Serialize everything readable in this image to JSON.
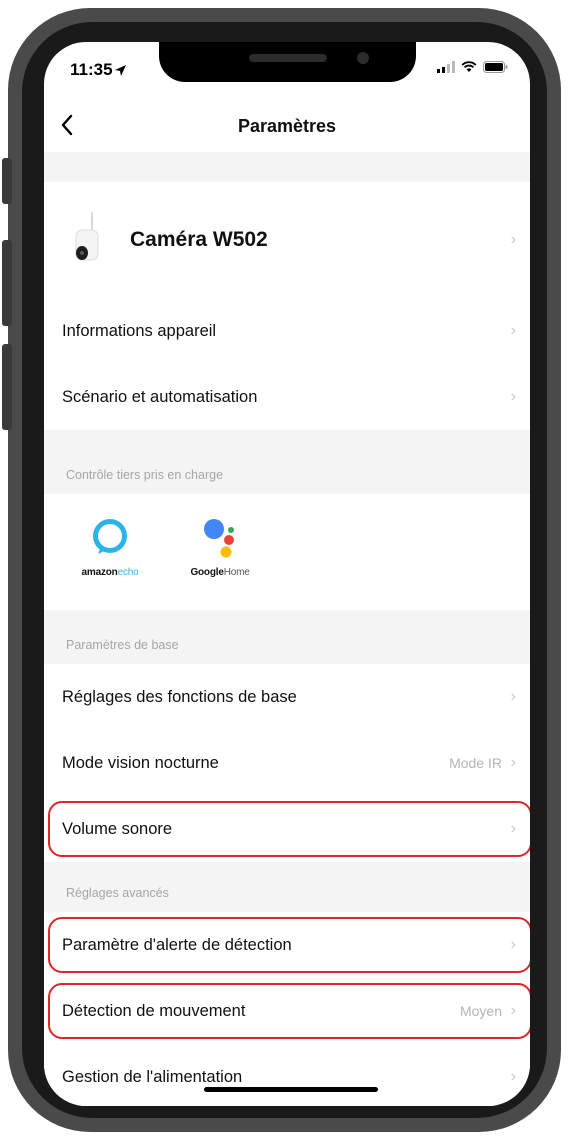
{
  "status": {
    "time": "11:35",
    "location_icon": "location-arrow-icon",
    "signal_icon": "signal-icon",
    "wifi_icon": "wifi-icon",
    "battery_icon": "battery-icon"
  },
  "nav": {
    "title": "Paramètres",
    "back_icon": "chevron-left-icon"
  },
  "device": {
    "name": "Caméra W502",
    "icon": "camera-device-icon"
  },
  "rows_top": [
    {
      "label": "Informations appareil"
    },
    {
      "label": "Scénario et automatisation"
    }
  ],
  "third_party": {
    "section_label": "Contrôle tiers pris en charge",
    "amazon": {
      "brand": "amazon",
      "product": "echo"
    },
    "google": {
      "brand": "Google",
      "product": "Home"
    }
  },
  "basic": {
    "section_label": "Paramètres de base",
    "rows": [
      {
        "label": "Réglages des fonctions de base",
        "value": ""
      },
      {
        "label": "Mode vision nocturne",
        "value": "Mode IR"
      },
      {
        "label": "Volume sonore",
        "value": ""
      }
    ]
  },
  "advanced": {
    "section_label": "Réglages avancés",
    "rows": [
      {
        "label": "Paramètre d'alerte de détection",
        "value": ""
      },
      {
        "label": "Détection de mouvement",
        "value": "Moyen"
      },
      {
        "label": "Gestion de l'alimentation",
        "value": ""
      }
    ]
  },
  "colors": {
    "highlight": "#e0252b",
    "alexa_blue": "#2cb4e8",
    "google_blue": "#4285f4",
    "google_red": "#ea4335",
    "google_yellow": "#fbbc05",
    "google_green": "#34a853"
  }
}
